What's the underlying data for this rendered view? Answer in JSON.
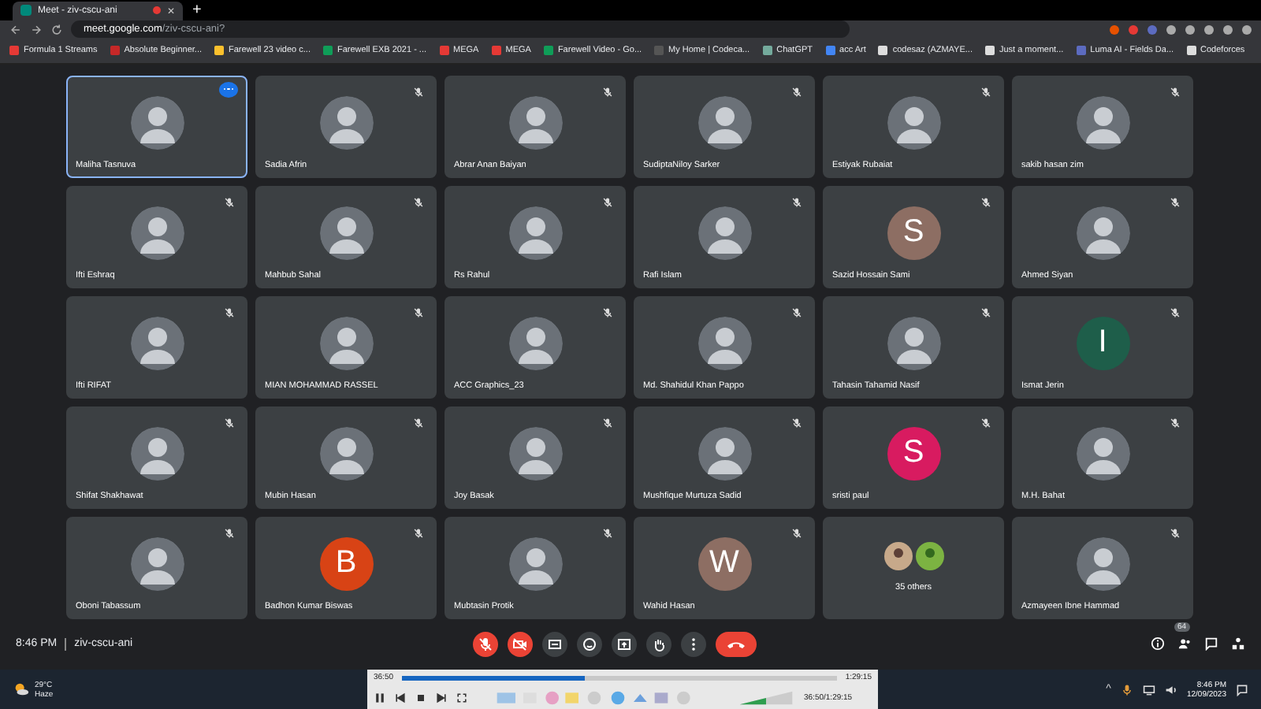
{
  "browser": {
    "tab": {
      "title": "Meet - ziv-cscu-ani",
      "recording": true,
      "close": "✕"
    },
    "new_tab": "+",
    "url_host": "meet.google.com",
    "url_path": "/ziv-cscu-ani?",
    "bookmarks": [
      "Formula 1 Streams",
      "Absolute Beginner...",
      "Farewell 23 video c...",
      "Farewell EXB 2021 - ...",
      "MEGA",
      "MEGA",
      "Farewell Video - Go...",
      "My Home | Codeca...",
      "ChatGPT",
      "acc Art",
      "codesaz (AZMAYE...",
      "Just a moment...",
      "Luma AI - Fields Da...",
      "Codeforces"
    ]
  },
  "tiles": [
    {
      "name": "Maliha Tasnuva",
      "kind": "photo",
      "muted": false,
      "selected": true
    },
    {
      "name": "Sadia Afrin",
      "kind": "photo",
      "muted": true,
      "selected": false
    },
    {
      "name": "Abrar Anan Baiyan",
      "kind": "photo",
      "muted": true,
      "selected": false
    },
    {
      "name": "SudiptaNiloy Sarker",
      "kind": "photo",
      "muted": true,
      "selected": false
    },
    {
      "name": "Estiyak Rubaiat",
      "kind": "photo",
      "muted": true,
      "selected": false
    },
    {
      "name": "sakib hasan zim",
      "kind": "photo",
      "muted": true,
      "selected": false
    },
    {
      "name": "Ifti Eshraq",
      "kind": "photo",
      "muted": true,
      "selected": false
    },
    {
      "name": "Mahbub Sahal",
      "kind": "photo",
      "muted": true,
      "selected": false
    },
    {
      "name": "Rs Rahul",
      "kind": "photo",
      "muted": true,
      "selected": false
    },
    {
      "name": "Rafi Islam",
      "kind": "photo",
      "muted": true,
      "selected": false
    },
    {
      "name": "Sazid Hossain Sami",
      "kind": "letter",
      "letter": "S",
      "color": "#8d6e63",
      "muted": true,
      "selected": false
    },
    {
      "name": "Ahmed Siyan",
      "kind": "photo",
      "muted": true,
      "selected": false
    },
    {
      "name": "Ifti RIFAT",
      "kind": "photo",
      "muted": true,
      "selected": false
    },
    {
      "name": "MIAN MOHAMMAD RASSEL",
      "kind": "photo",
      "muted": true,
      "selected": false
    },
    {
      "name": "ACC Graphics_23",
      "kind": "photo",
      "muted": true,
      "selected": false
    },
    {
      "name": "Md. Shahidul Khan Pappo",
      "kind": "photo",
      "muted": true,
      "selected": false
    },
    {
      "name": "Tahasin Tahamid Nasif",
      "kind": "photo",
      "muted": true,
      "selected": false
    },
    {
      "name": "Ismat Jerin",
      "kind": "letter",
      "letter": "I",
      "color": "#1e5e4a",
      "muted": true,
      "selected": false
    },
    {
      "name": "Shifat Shakhawat",
      "kind": "photo",
      "muted": true,
      "selected": false
    },
    {
      "name": "Mubin Hasan",
      "kind": "photo",
      "muted": true,
      "selected": false
    },
    {
      "name": "Joy Basak",
      "kind": "photo",
      "muted": true,
      "selected": false
    },
    {
      "name": "Mushfique Murtuza Sadid",
      "kind": "photo",
      "muted": true,
      "selected": false
    },
    {
      "name": "sristi paul",
      "kind": "letter",
      "letter": "S",
      "color": "#d81b60",
      "muted": true,
      "selected": false
    },
    {
      "name": "M.H. Bahat",
      "kind": "photo",
      "muted": true,
      "selected": false
    },
    {
      "name": "Oboni Tabassum",
      "kind": "photo",
      "muted": true,
      "selected": false
    },
    {
      "name": "Badhon Kumar Biswas",
      "kind": "letter",
      "letter": "B",
      "color": "#d84315",
      "muted": true,
      "selected": false
    },
    {
      "name": "Mubtasin Protik",
      "kind": "photo",
      "muted": true,
      "selected": false
    },
    {
      "name": "Wahid Hasan",
      "kind": "letter",
      "letter": "W",
      "color": "#8d6e63",
      "muted": true,
      "selected": false
    },
    {
      "name": "35 others",
      "kind": "others",
      "selected": false
    },
    {
      "name": "Azmayeen Ibne Hammad",
      "kind": "photo",
      "muted": true,
      "selected": false
    }
  ],
  "meeting_bar": {
    "time": "8:46 PM",
    "code": "ziv-cscu-ani",
    "mic_on": false,
    "camera_on": false,
    "people_count": "64"
  },
  "player": {
    "elapsed": "36:50",
    "total": "1:29:15",
    "level": 0.42,
    "readout": "36:50/1:29:15"
  },
  "taskbar": {
    "tray_toggle": "^",
    "temperature": "29°C",
    "weather": "Haze",
    "time": "8:46 PM",
    "date": "12/09/2023"
  }
}
